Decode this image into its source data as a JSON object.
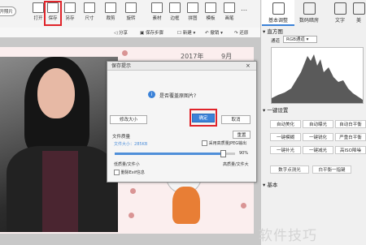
{
  "toolbar": {
    "open_photo": "开照片",
    "items": [
      {
        "label": "打开"
      },
      {
        "label": "保存"
      },
      {
        "label": "另存"
      },
      {
        "label": "尺寸"
      },
      {
        "label": "裁剪"
      },
      {
        "label": "旋转"
      },
      {
        "label": "素材"
      },
      {
        "label": "边框"
      },
      {
        "label": "拼图"
      },
      {
        "label": "模板"
      },
      {
        "label": "画笔"
      }
    ],
    "row2": {
      "share": "分享",
      "save_step": "保存步骤",
      "new": "新建",
      "undo": "撤销",
      "redo": "还原"
    }
  },
  "canvas": {
    "year": "2017年",
    "month": "9月"
  },
  "right_panel": {
    "tabs": [
      "基本调整",
      "数码暗房",
      "文字",
      "美"
    ],
    "histogram_title": "直方图",
    "channel_label": "通道",
    "channel_value": "RGB通道",
    "quick_settings_title": "一键设置",
    "buttons": [
      "自动美化",
      "自动曝光",
      "自动白平衡",
      "一键模糊",
      "一键锐化",
      "严重白平衡",
      "一键补光",
      "一键减光",
      "高ISO降噪"
    ],
    "bottom_buttons": [
      "数字点测光",
      "白平衡一指键"
    ],
    "basic_title": "基本"
  },
  "dialog": {
    "title": "保存提示",
    "question": "是否覆盖原图片?",
    "resize_button": "修改大小",
    "ok_button": "确定",
    "cancel_button": "取消",
    "quality_label": "文件质量",
    "reset_button": "重置",
    "file_size_label": "文件大小：",
    "file_size_value": "285KB",
    "jpeg_option": "采用高质量JPEG输出",
    "quality_percent": "90%",
    "quality_value": 0.9,
    "low_label": "低质量/文件小",
    "high_label": "高质量/文件大",
    "exif_label": "删除Exif信息"
  },
  "watermark": "软件技巧"
}
